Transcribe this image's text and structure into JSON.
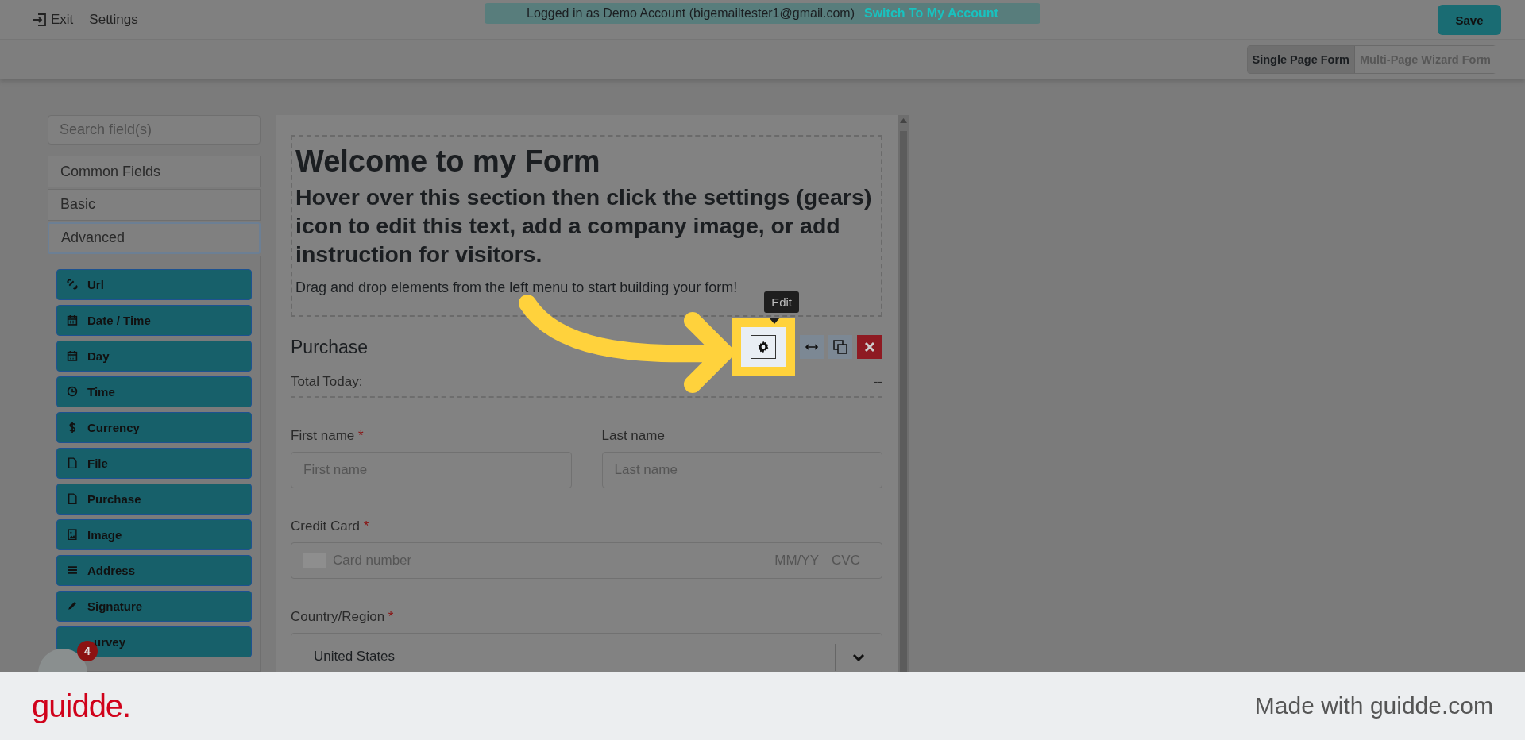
{
  "top_bar": {
    "exit": "Exit",
    "settings": "Settings",
    "login_notice": "Logged in as Demo Account (bigemailtester1@gmail.com)",
    "switch_link": "Switch To My Account",
    "save": "Save"
  },
  "form_type_tabs": [
    {
      "label": "Single Page Form",
      "selected": true
    },
    {
      "label": "Multi-Page Wizard Form",
      "selected": false
    }
  ],
  "sidebar": {
    "search": {
      "placeholder": "Search field(s)"
    },
    "groups": [
      {
        "label": "Common Fields",
        "expanded": false
      },
      {
        "label": "Basic",
        "expanded": false
      },
      {
        "label": "Advanced",
        "expanded": true
      }
    ],
    "fields": [
      {
        "label": "Url",
        "kind": "link"
      },
      {
        "label": "Date / Time",
        "kind": "calendar"
      },
      {
        "label": "Day",
        "kind": "calendar"
      },
      {
        "label": "Time",
        "kind": "clock"
      },
      {
        "label": "Currency",
        "kind": "dollar"
      },
      {
        "label": "File",
        "kind": "file"
      },
      {
        "label": "Purchase",
        "kind": "file"
      },
      {
        "label": "Image",
        "kind": "image"
      },
      {
        "label": "Address",
        "kind": "lines"
      },
      {
        "label": "Signature",
        "kind": "pencil"
      },
      {
        "label": "urvey",
        "kind": "none"
      }
    ]
  },
  "chat_badge": "4",
  "form": {
    "title": "Welcome to my Form",
    "subtitle": "Hover over this section then click the settings (gears) icon to edit this text, add a company image, or add instruction for visitors.",
    "instructions": "Drag and drop elements from the left menu to start building your form!",
    "section": "Purchase",
    "tooltip": "Edit",
    "total_label": "Total Today:",
    "total_value": "--",
    "required_mark": "*",
    "name_fields": [
      {
        "label": "First name",
        "required": true,
        "placeholder": "First name"
      },
      {
        "label": "Last name",
        "required": false,
        "placeholder": "Last name"
      }
    ],
    "card": {
      "label": "Credit Card",
      "required": true,
      "placeholder": "Card number",
      "expiry": "MM/YY",
      "cvc": "CVC"
    },
    "country": {
      "label": "Country/Region",
      "required": true,
      "value": "United States"
    }
  },
  "footer": {
    "brand": "guidde.",
    "credit": "Made with guidde.com"
  }
}
